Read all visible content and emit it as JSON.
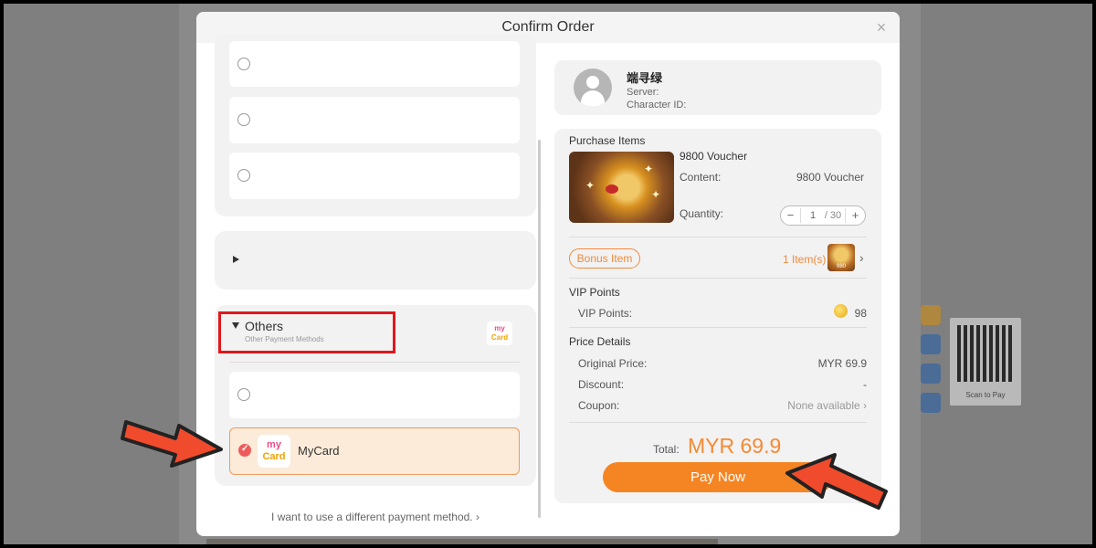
{
  "modal": {
    "title": "Confirm Order",
    "close_icon": "×"
  },
  "left_panel": {
    "others_group": {
      "title": "Others",
      "subtitle": "Other Payment Methods"
    },
    "selected_method": {
      "name": "MyCard",
      "logo_line1": "my",
      "logo_line2": "Card"
    },
    "different_method_link": "I want to use a different payment method.  ›"
  },
  "user": {
    "name": "端寻绿",
    "server_label": "Server:",
    "character_label": "Character ID:"
  },
  "purchase": {
    "section_title": "Purchase Items",
    "item_name": "9800 Voucher",
    "content_label": "Content:",
    "content_value": "9800 Voucher",
    "quantity_label": "Quantity:",
    "quantity_value": "1",
    "quantity_max": "/ 30",
    "bonus_label": "Bonus Item",
    "bonus_count": "1 Item(s)",
    "bonus_thumb_text": "980"
  },
  "vip": {
    "section_title": "VIP Points",
    "label": "VIP Points:",
    "value": "98"
  },
  "price": {
    "section_title": "Price Details",
    "original_label": "Original Price:",
    "original_value": "MYR 69.9",
    "discount_label": "Discount:",
    "discount_value": "-",
    "coupon_label": "Coupon:",
    "coupon_value": "None available  ›"
  },
  "total": {
    "label": "Total:",
    "value": "MYR 69.9"
  },
  "pay_button": "Pay Now",
  "background": {
    "qr_caption": "Scan to Pay"
  },
  "colors": {
    "accent": "#f58523",
    "highlight": "#e0171c",
    "annotation_arrow": "#f04b2c"
  }
}
